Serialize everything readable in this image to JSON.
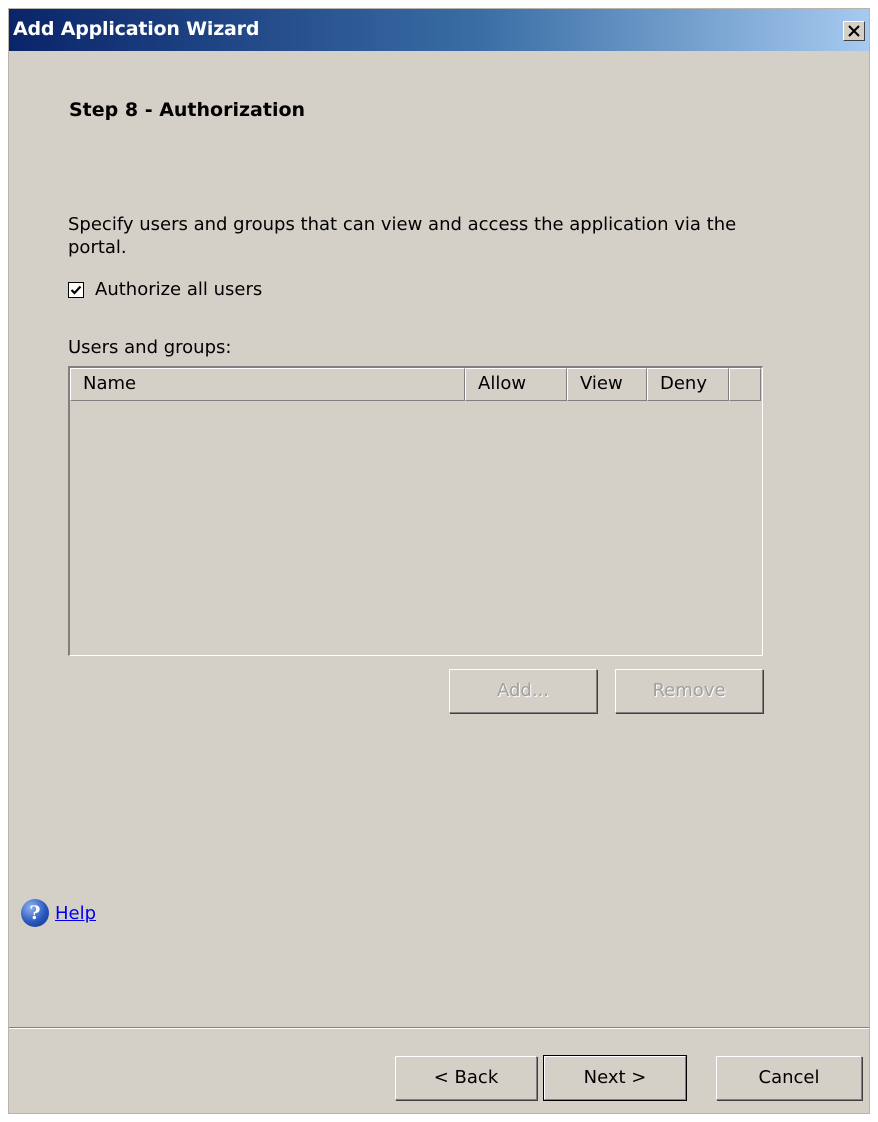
{
  "window": {
    "title": "Add Application Wizard",
    "close_glyph": "✕"
  },
  "step": {
    "title": "Step 8 - Authorization"
  },
  "description": "Specify users and groups that can view and access the application via the portal.",
  "authorize_all": {
    "label": "Authorize all users",
    "checked": true
  },
  "users_groups": {
    "label": "Users and groups:",
    "columns": [
      "Name",
      "Allow",
      "View",
      "Deny"
    ],
    "rows": []
  },
  "buttons": {
    "add": "Add...",
    "remove": "Remove",
    "back": "< Back",
    "next": "Next >",
    "cancel": "Cancel"
  },
  "help": {
    "icon_glyph": "?",
    "link": "Help"
  }
}
